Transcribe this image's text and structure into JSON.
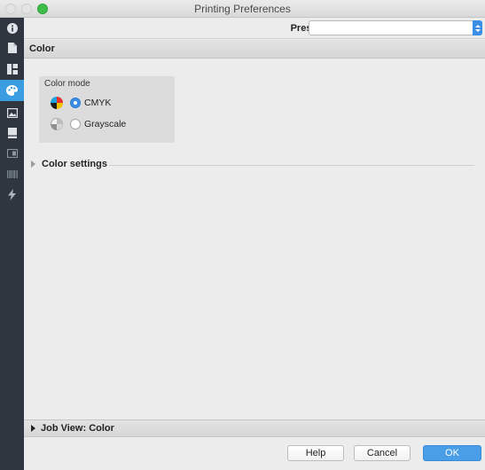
{
  "window": {
    "title": "Printing Preferences"
  },
  "sidebar": {
    "items": [
      {
        "icon": "info-icon",
        "active": false
      },
      {
        "icon": "document-icon",
        "active": false
      },
      {
        "icon": "layout-icon",
        "active": false
      },
      {
        "icon": "palette-icon",
        "active": true
      },
      {
        "icon": "image-icon",
        "active": false
      },
      {
        "icon": "page-icon",
        "active": false
      },
      {
        "icon": "media-icon",
        "active": false
      },
      {
        "icon": "barcode-icon",
        "active": false
      },
      {
        "icon": "bolt-icon",
        "active": false
      }
    ]
  },
  "presets": {
    "label": "Presets:",
    "value": ""
  },
  "section": {
    "title": "Color"
  },
  "color_mode": {
    "label": "Color mode",
    "options": [
      {
        "label": "CMYK",
        "selected": true,
        "icon": "cmyk-icon"
      },
      {
        "label": "Grayscale",
        "selected": false,
        "icon": "grayscale-icon"
      }
    ]
  },
  "color_settings": {
    "label": "Color settings",
    "expanded": false
  },
  "job_view": {
    "label": "Job View: Color"
  },
  "footer": {
    "help_label": "Help",
    "cancel_label": "Cancel",
    "ok_label": "OK"
  },
  "colors": {
    "accent": "#3b8ee6",
    "sidebar_bg": "#2f3640",
    "sidebar_active": "#3b9de1",
    "ok_button": "#4a9ee8"
  }
}
